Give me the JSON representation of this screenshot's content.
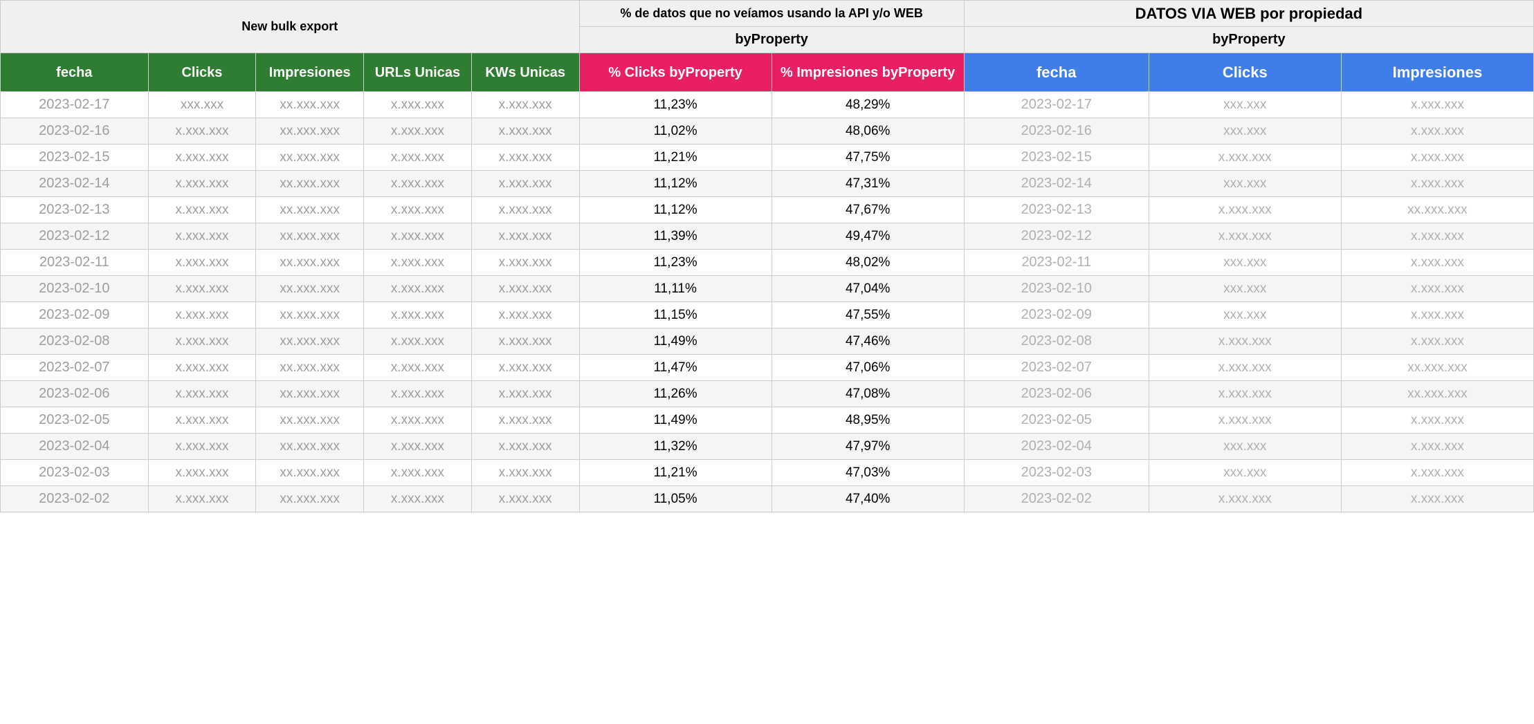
{
  "sections": {
    "bulk": {
      "title": "New bulk export"
    },
    "pct": {
      "title": "% de datos que no veíamos usando la API y/o WEB",
      "sub": "byProperty"
    },
    "web": {
      "title": "DATOS VIA WEB por propiedad",
      "sub": "byProperty"
    }
  },
  "headers": {
    "bulk": [
      "fecha",
      "Clicks",
      "Impresiones",
      "URLs Unicas",
      "KWs Unicas"
    ],
    "pct": [
      "% Clicks byProperty",
      "% Impresiones byProperty"
    ],
    "web": [
      "fecha",
      "Clicks",
      "Impresiones"
    ]
  },
  "chart_data": {
    "type": "table",
    "title": "Comparativa bulk export vs API/WEB por propiedad",
    "columns": [
      "fecha_bulk",
      "clicks_bulk",
      "impresiones_bulk",
      "urls_unicas",
      "kws_unicas",
      "pct_clicks_byProperty",
      "pct_impresiones_byProperty",
      "fecha_web",
      "clicks_web",
      "impresiones_web"
    ],
    "rows": [
      {
        "fecha_bulk": "2023-02-17",
        "clicks_bulk": "xxx.xxx",
        "impresiones_bulk": "xx.xxx.xxx",
        "urls_unicas": "x.xxx.xxx",
        "kws_unicas": "x.xxx.xxx",
        "pct_clicks_byProperty": "11,23%",
        "pct_impresiones_byProperty": "48,29%",
        "fecha_web": "2023-02-17",
        "clicks_web": "xxx.xxx",
        "impresiones_web": "x.xxx.xxx"
      },
      {
        "fecha_bulk": "2023-02-16",
        "clicks_bulk": "x.xxx.xxx",
        "impresiones_bulk": "xx.xxx.xxx",
        "urls_unicas": "x.xxx.xxx",
        "kws_unicas": "x.xxx.xxx",
        "pct_clicks_byProperty": "11,02%",
        "pct_impresiones_byProperty": "48,06%",
        "fecha_web": "2023-02-16",
        "clicks_web": "xxx.xxx",
        "impresiones_web": "x.xxx.xxx"
      },
      {
        "fecha_bulk": "2023-02-15",
        "clicks_bulk": "x.xxx.xxx",
        "impresiones_bulk": "xx.xxx.xxx",
        "urls_unicas": "x.xxx.xxx",
        "kws_unicas": "x.xxx.xxx",
        "pct_clicks_byProperty": "11,21%",
        "pct_impresiones_byProperty": "47,75%",
        "fecha_web": "2023-02-15",
        "clicks_web": "x.xxx.xxx",
        "impresiones_web": "x.xxx.xxx"
      },
      {
        "fecha_bulk": "2023-02-14",
        "clicks_bulk": "x.xxx.xxx",
        "impresiones_bulk": "xx.xxx.xxx",
        "urls_unicas": "x.xxx.xxx",
        "kws_unicas": "x.xxx.xxx",
        "pct_clicks_byProperty": "11,12%",
        "pct_impresiones_byProperty": "47,31%",
        "fecha_web": "2023-02-14",
        "clicks_web": "xxx.xxx",
        "impresiones_web": "x.xxx.xxx"
      },
      {
        "fecha_bulk": "2023-02-13",
        "clicks_bulk": "x.xxx.xxx",
        "impresiones_bulk": "xx.xxx.xxx",
        "urls_unicas": "x.xxx.xxx",
        "kws_unicas": "x.xxx.xxx",
        "pct_clicks_byProperty": "11,12%",
        "pct_impresiones_byProperty": "47,67%",
        "fecha_web": "2023-02-13",
        "clicks_web": "x.xxx.xxx",
        "impresiones_web": "xx.xxx.xxx"
      },
      {
        "fecha_bulk": "2023-02-12",
        "clicks_bulk": "x.xxx.xxx",
        "impresiones_bulk": "xx.xxx.xxx",
        "urls_unicas": "x.xxx.xxx",
        "kws_unicas": "x.xxx.xxx",
        "pct_clicks_byProperty": "11,39%",
        "pct_impresiones_byProperty": "49,47%",
        "fecha_web": "2023-02-12",
        "clicks_web": "x.xxx.xxx",
        "impresiones_web": "x.xxx.xxx"
      },
      {
        "fecha_bulk": "2023-02-11",
        "clicks_bulk": "x.xxx.xxx",
        "impresiones_bulk": "xx.xxx.xxx",
        "urls_unicas": "x.xxx.xxx",
        "kws_unicas": "x.xxx.xxx",
        "pct_clicks_byProperty": "11,23%",
        "pct_impresiones_byProperty": "48,02%",
        "fecha_web": "2023-02-11",
        "clicks_web": "xxx.xxx",
        "impresiones_web": "x.xxx.xxx"
      },
      {
        "fecha_bulk": "2023-02-10",
        "clicks_bulk": "x.xxx.xxx",
        "impresiones_bulk": "xx.xxx.xxx",
        "urls_unicas": "x.xxx.xxx",
        "kws_unicas": "x.xxx.xxx",
        "pct_clicks_byProperty": "11,11%",
        "pct_impresiones_byProperty": "47,04%",
        "fecha_web": "2023-02-10",
        "clicks_web": "xxx.xxx",
        "impresiones_web": "x.xxx.xxx"
      },
      {
        "fecha_bulk": "2023-02-09",
        "clicks_bulk": "x.xxx.xxx",
        "impresiones_bulk": "xx.xxx.xxx",
        "urls_unicas": "x.xxx.xxx",
        "kws_unicas": "x.xxx.xxx",
        "pct_clicks_byProperty": "11,15%",
        "pct_impresiones_byProperty": "47,55%",
        "fecha_web": "2023-02-09",
        "clicks_web": "xxx.xxx",
        "impresiones_web": "x.xxx.xxx"
      },
      {
        "fecha_bulk": "2023-02-08",
        "clicks_bulk": "x.xxx.xxx",
        "impresiones_bulk": "xx.xxx.xxx",
        "urls_unicas": "x.xxx.xxx",
        "kws_unicas": "x.xxx.xxx",
        "pct_clicks_byProperty": "11,49%",
        "pct_impresiones_byProperty": "47,46%",
        "fecha_web": "2023-02-08",
        "clicks_web": "x.xxx.xxx",
        "impresiones_web": "x.xxx.xxx"
      },
      {
        "fecha_bulk": "2023-02-07",
        "clicks_bulk": "x.xxx.xxx",
        "impresiones_bulk": "xx.xxx.xxx",
        "urls_unicas": "x.xxx.xxx",
        "kws_unicas": "x.xxx.xxx",
        "pct_clicks_byProperty": "11,47%",
        "pct_impresiones_byProperty": "47,06%",
        "fecha_web": "2023-02-07",
        "clicks_web": "x.xxx.xxx",
        "impresiones_web": "xx.xxx.xxx"
      },
      {
        "fecha_bulk": "2023-02-06",
        "clicks_bulk": "x.xxx.xxx",
        "impresiones_bulk": "xx.xxx.xxx",
        "urls_unicas": "x.xxx.xxx",
        "kws_unicas": "x.xxx.xxx",
        "pct_clicks_byProperty": "11,26%",
        "pct_impresiones_byProperty": "47,08%",
        "fecha_web": "2023-02-06",
        "clicks_web": "x.xxx.xxx",
        "impresiones_web": "xx.xxx.xxx"
      },
      {
        "fecha_bulk": "2023-02-05",
        "clicks_bulk": "x.xxx.xxx",
        "impresiones_bulk": "xx.xxx.xxx",
        "urls_unicas": "x.xxx.xxx",
        "kws_unicas": "x.xxx.xxx",
        "pct_clicks_byProperty": "11,49%",
        "pct_impresiones_byProperty": "48,95%",
        "fecha_web": "2023-02-05",
        "clicks_web": "x.xxx.xxx",
        "impresiones_web": "x.xxx.xxx"
      },
      {
        "fecha_bulk": "2023-02-04",
        "clicks_bulk": "x.xxx.xxx",
        "impresiones_bulk": "xx.xxx.xxx",
        "urls_unicas": "x.xxx.xxx",
        "kws_unicas": "x.xxx.xxx",
        "pct_clicks_byProperty": "11,32%",
        "pct_impresiones_byProperty": "47,97%",
        "fecha_web": "2023-02-04",
        "clicks_web": "xxx.xxx",
        "impresiones_web": "x.xxx.xxx"
      },
      {
        "fecha_bulk": "2023-02-03",
        "clicks_bulk": "x.xxx.xxx",
        "impresiones_bulk": "xx.xxx.xxx",
        "urls_unicas": "x.xxx.xxx",
        "kws_unicas": "x.xxx.xxx",
        "pct_clicks_byProperty": "11,21%",
        "pct_impresiones_byProperty": "47,03%",
        "fecha_web": "2023-02-03",
        "clicks_web": "xxx.xxx",
        "impresiones_web": "x.xxx.xxx"
      },
      {
        "fecha_bulk": "2023-02-02",
        "clicks_bulk": "x.xxx.xxx",
        "impresiones_bulk": "xx.xxx.xxx",
        "urls_unicas": "x.xxx.xxx",
        "kws_unicas": "x.xxx.xxx",
        "pct_clicks_byProperty": "11,05%",
        "pct_impresiones_byProperty": "47,40%",
        "fecha_web": "2023-02-02",
        "clicks_web": "x.xxx.xxx",
        "impresiones_web": "x.xxx.xxx"
      }
    ]
  }
}
